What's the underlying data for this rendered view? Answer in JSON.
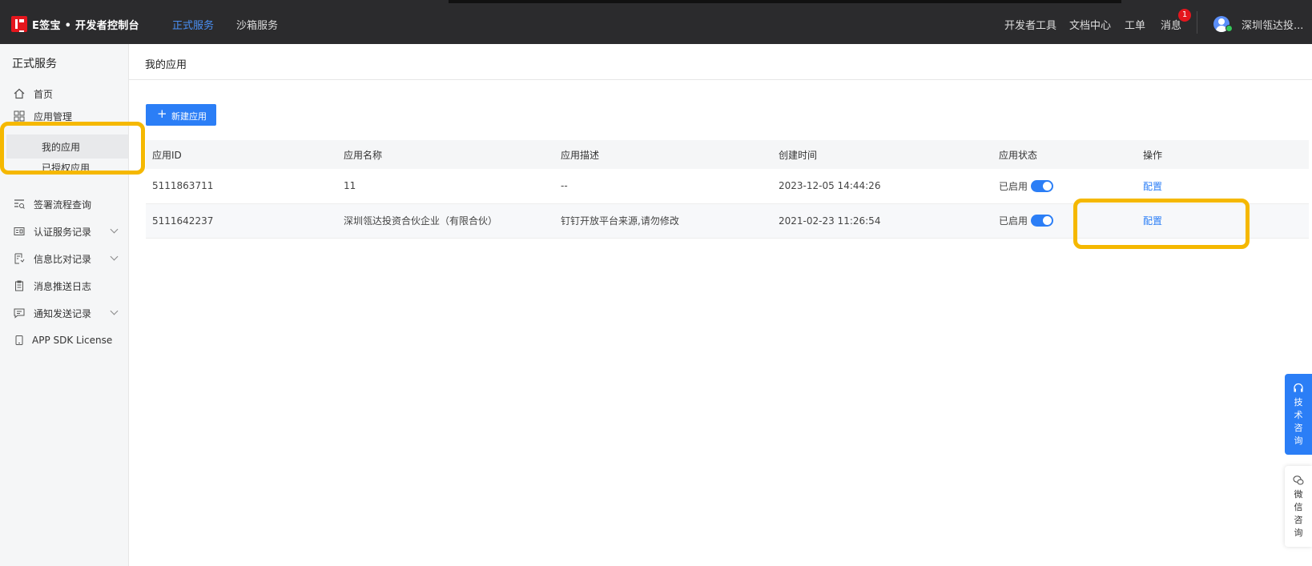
{
  "brand": {
    "name": "E签宝 • 开发者控制台",
    "accent": "#2b7ef6",
    "logo_color": "#e4161d"
  },
  "topnav": {
    "active": "正式服务",
    "other": "沙箱服务"
  },
  "header_right": {
    "dev_tools": "开发者工具",
    "docs": "文档中心",
    "ticket": "工单",
    "messages": "消息",
    "message_badge": "1",
    "user_name": "深圳瓴达投..."
  },
  "sidebar": {
    "title": "正式服务",
    "items": [
      {
        "label": "首页",
        "icon": "home-icon"
      },
      {
        "label": "应用管理",
        "icon": "grid-icon"
      },
      {
        "label": "我的应用",
        "icon": ""
      },
      {
        "label": "已授权应用",
        "icon": ""
      },
      {
        "label": "签署流程查询",
        "icon": "search-list-icon"
      },
      {
        "label": "认证服务记录",
        "icon": "id-card-icon"
      },
      {
        "label": "信息比对记录",
        "icon": "compare-icon"
      },
      {
        "label": "消息推送日志",
        "icon": "clipboard-icon"
      },
      {
        "label": "通知发送记录",
        "icon": "message-icon"
      },
      {
        "label": "APP SDK License",
        "icon": "device-icon"
      }
    ]
  },
  "main": {
    "title": "我的应用",
    "new_button": "新建应用",
    "table": {
      "columns": [
        "应用ID",
        "应用名称",
        "应用描述",
        "创建时间",
        "应用状态",
        "操作"
      ],
      "rows": [
        {
          "id": "5111863711",
          "name": "11",
          "desc": "--",
          "created": "2023-12-05 14:44:26",
          "status": "已启用",
          "action": "配置"
        },
        {
          "id": "5111642237",
          "name": "深圳瓴达投资合伙企业（有限合伙）",
          "desc": "钉钉开放平台来源,请勿修改",
          "created": "2021-02-23 11:26:54",
          "status": "已启用",
          "action": "配置"
        }
      ]
    }
  },
  "float": {
    "tech": "技术咨询",
    "wechat": "微信咨询"
  },
  "highlight_color": "#f5b800"
}
